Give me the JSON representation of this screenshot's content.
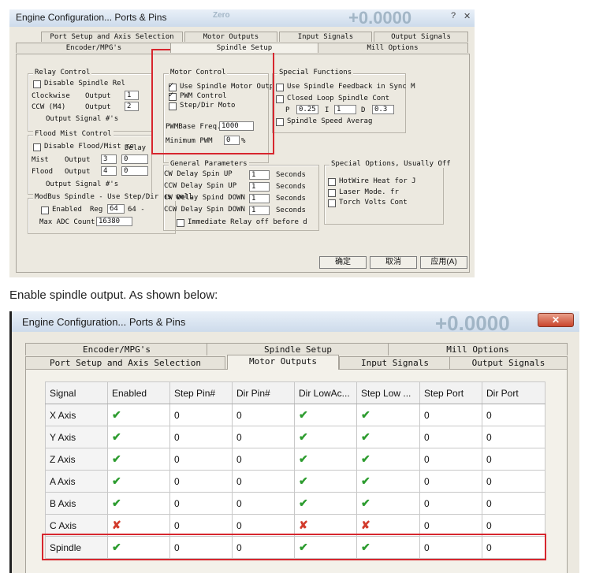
{
  "screenshot1": {
    "window_title": "Engine Configuration... Ports & Pins",
    "bg_label": "Zero",
    "bg_number": "+0.0000",
    "tabs_row1": [
      "Port Setup and Axis Selection",
      "Motor Outputs",
      "Input Signals",
      "Output Signals"
    ],
    "tabs_row2": [
      "Encoder/MPG's",
      "Spindle Setup",
      "Mill Options"
    ],
    "active_tab": "Spindle Setup",
    "relay_control": {
      "title": "Relay Control",
      "disable_label": "Disable Spindle Rel",
      "cw_label": "Clockwise",
      "ccw_label": "CCW (M4)",
      "output_label": "Output",
      "cw_output": "1",
      "ccw_output": "2",
      "footer": "Output Signal #'s"
    },
    "flood_mist": {
      "title": "Flood Mist Control",
      "disable_label": "Disable Flood/Mist re",
      "delay_label": "Delay",
      "mist_label": "Mist",
      "flood_label": "Flood",
      "output_label": "Output",
      "mist_output": "3",
      "mist_delay": "0",
      "flood_output": "4",
      "flood_delay": "0",
      "footer": "Output Signal #'s"
    },
    "modbus": {
      "title": "ModBus Spindle - Use Step/Dir as well",
      "enabled_label": "Enabled",
      "reg_label": "Reg",
      "reg_value": "64",
      "reg_suffix": "64 -",
      "max_adc_label": "Max ADC Count",
      "max_adc_value": "16380"
    },
    "motor_control": {
      "title": "Motor Control",
      "use_spindle_label": "Use Spindle Motor Outp",
      "pwm_label": "PWM Control",
      "stepdir_label": "Step/Dir Moto",
      "pwm_base_label": "PWMBase Freq.",
      "pwm_base_value": "1000",
      "min_pwm_label": "Minimum PWM",
      "min_pwm_value": "0",
      "percent": "%"
    },
    "special_functions": {
      "title": "Special Functions",
      "feedback_label": "Use Spindle Feedback in Sync M",
      "closed_loop_label": "Closed Loop Spindle Cont",
      "p_label": "P",
      "p_value": "0.25",
      "i_label": "I",
      "i_value": "1",
      "d_label": "D",
      "d_value": "0.3",
      "speed_avg_label": "Spindle Speed Averag"
    },
    "general_params": {
      "title": "General Parameters",
      "rows": [
        {
          "label": "CW Delay Spin UP",
          "value": "1",
          "unit": "Seconds"
        },
        {
          "label": "CCW Delay Spin UP",
          "value": "1",
          "unit": "Seconds"
        },
        {
          "label": "CW Delay Spind DOWN",
          "value": "1",
          "unit": "Seconds"
        },
        {
          "label": "CCW Delay Spin DOWN",
          "value": "1",
          "unit": "Seconds"
        }
      ],
      "immediate_label": "Immediate Relay off before d"
    },
    "special_options": {
      "title": "Special Options, Usually Off",
      "hotwire_label": "HotWire Heat for J",
      "laser_label": "Laser Mode. fr",
      "torch_label": "Torch Volts Cont"
    },
    "buttons": {
      "ok": "确定",
      "cancel": "取消",
      "apply": "应用(A)"
    }
  },
  "caption": "Enable spindle output. As shown below:",
  "screenshot2": {
    "window_title": "Engine Configuration... Ports & Pins",
    "bg_number": "+0.0000",
    "tabs_row1": [
      "Encoder/MPG's",
      "Spindle Setup",
      "Mill Options"
    ],
    "tabs_row2": [
      "Port Setup and Axis Selection",
      "Motor Outputs",
      "Input Signals",
      "Output Signals"
    ],
    "active_tab": "Motor Outputs",
    "columns": [
      "Signal",
      "Enabled",
      "Step Pin#",
      "Dir Pin#",
      "Dir LowAc...",
      "Step Low ...",
      "Step Port",
      "Dir Port"
    ],
    "rows": [
      {
        "signal": "X Axis",
        "enabled": true,
        "step_pin": "0",
        "dir_pin": "0",
        "dir_low": true,
        "step_low": true,
        "step_port": "0",
        "dir_port": "0"
      },
      {
        "signal": "Y Axis",
        "enabled": true,
        "step_pin": "0",
        "dir_pin": "0",
        "dir_low": true,
        "step_low": true,
        "step_port": "0",
        "dir_port": "0"
      },
      {
        "signal": "Z Axis",
        "enabled": true,
        "step_pin": "0",
        "dir_pin": "0",
        "dir_low": true,
        "step_low": true,
        "step_port": "0",
        "dir_port": "0"
      },
      {
        "signal": "A Axis",
        "enabled": true,
        "step_pin": "0",
        "dir_pin": "0",
        "dir_low": true,
        "step_low": true,
        "step_port": "0",
        "dir_port": "0"
      },
      {
        "signal": "B Axis",
        "enabled": true,
        "step_pin": "0",
        "dir_pin": "0",
        "dir_low": true,
        "step_low": true,
        "step_port": "0",
        "dir_port": "0"
      },
      {
        "signal": "C Axis",
        "enabled": false,
        "step_pin": "0",
        "dir_pin": "0",
        "dir_low": false,
        "step_low": false,
        "step_port": "0",
        "dir_port": "0"
      },
      {
        "signal": "Spindle",
        "enabled": true,
        "step_pin": "0",
        "dir_pin": "0",
        "dir_low": true,
        "step_low": true,
        "step_port": "0",
        "dir_port": "0"
      }
    ]
  },
  "icons": {
    "check": "green-check-icon",
    "cross": "red-x-icon"
  },
  "colors": {
    "highlight": "#d7262e",
    "check": "#2d9c2f",
    "cross": "#d23b2c"
  }
}
